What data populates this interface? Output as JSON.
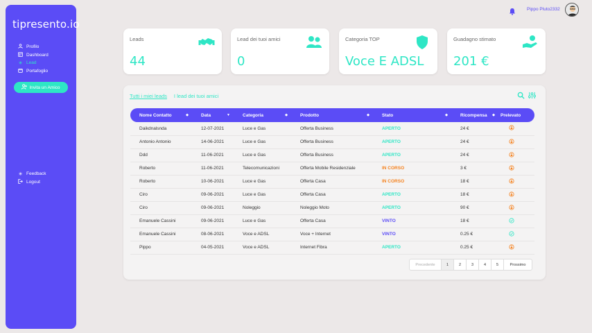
{
  "app": {
    "logo": "tipresento.io"
  },
  "sidebar": {
    "items": [
      {
        "label": "Profilo",
        "icon": "user-icon"
      },
      {
        "label": "Dashboard",
        "icon": "dashboard-icon"
      },
      {
        "label": "Lead",
        "icon": "asterisk-icon",
        "active": true
      },
      {
        "label": "Portafoglio",
        "icon": "wallet-icon"
      }
    ],
    "invite_label": "Invita un Amico",
    "bottom_items": [
      {
        "label": "Feedback",
        "icon": "asterisk-icon"
      },
      {
        "label": "Logout",
        "icon": "logout-icon"
      }
    ]
  },
  "topbar": {
    "username": "Pippo Pluto2332"
  },
  "cards": [
    {
      "label": "Leads",
      "value": "44",
      "icon": "handshake-icon"
    },
    {
      "label": "Lead dei tuoi amici",
      "value": "0",
      "icon": "users-icon"
    },
    {
      "label": "Categoria TOP",
      "value": "Voce E ADSL",
      "icon": "shield-icon"
    },
    {
      "label": "Guadagno stimato",
      "value": "201 €",
      "icon": "hand-money-icon"
    }
  ],
  "tabs": {
    "mine": "Tutti i miei leads",
    "friends": "I lead dei tuoi amici"
  },
  "table": {
    "headers": [
      "Nome Contatto",
      "Data",
      "Categoria",
      "Prodotto",
      "Stato",
      "Ricompensa",
      "Prelevato"
    ],
    "rows": [
      {
        "name": "Daikdnalsnda",
        "date": "12-07-2021",
        "cat": "Luce e Gas",
        "prod": "Offerta Business",
        "status": "APERTO",
        "reward": "24 €",
        "withdrawn": "coin"
      },
      {
        "name": "Antonio Antonio",
        "date": "14-06-2021",
        "cat": "Luce e Gas",
        "prod": "Offerta Business",
        "status": "APERTO",
        "reward": "24 €",
        "withdrawn": "coin"
      },
      {
        "name": "Ddd",
        "date": "11-06-2021",
        "cat": "Luce e Gas",
        "prod": "Offerta Business",
        "status": "APERTO",
        "reward": "24 €",
        "withdrawn": "coin"
      },
      {
        "name": "Roberto",
        "date": "11-06-2021",
        "cat": "Telecomunicazioni",
        "prod": "Offerta Mobile Residenziale",
        "status": "IN CORSO",
        "reward": "3 €",
        "withdrawn": "coin"
      },
      {
        "name": "Roberto",
        "date": "10-06-2021",
        "cat": "Luce e Gas",
        "prod": "Offerta Casa",
        "status": "IN CORSO",
        "reward": "18 €",
        "withdrawn": "coin"
      },
      {
        "name": "Ciro",
        "date": "09-06-2021",
        "cat": "Luce e Gas",
        "prod": "Offerta Casa",
        "status": "APERTO",
        "reward": "18 €",
        "withdrawn": "coin"
      },
      {
        "name": "Ciro",
        "date": "09-06-2021",
        "cat": "Noleggio",
        "prod": "Noleggio Moto",
        "status": "APERTO",
        "reward": "90 €",
        "withdrawn": "coin"
      },
      {
        "name": "Emanuele Cassini",
        "date": "09-06-2021",
        "cat": "Luce e Gas",
        "prod": "Offerta Casa",
        "status": "VINTO",
        "reward": "18 €",
        "withdrawn": "check"
      },
      {
        "name": "Emanuele Cassini",
        "date": "08-06-2021",
        "cat": "Voce e ADSL",
        "prod": "Voce + Internet",
        "status": "VINTO",
        "reward": "0.25 €",
        "withdrawn": "check"
      },
      {
        "name": "Pippo",
        "date": "04-05-2021",
        "cat": "Voce e ADSL",
        "prod": "Internet Fibra",
        "status": "APERTO",
        "reward": "0.25 €",
        "withdrawn": "coin"
      }
    ]
  },
  "pager": {
    "prev": "Precedente",
    "pages": [
      "1",
      "2",
      "3",
      "4",
      "5"
    ],
    "next": "Prossimo"
  },
  "colors": {
    "primary": "#5b4cf6",
    "accent": "#2ee6c5",
    "orange": "#f5821f"
  }
}
